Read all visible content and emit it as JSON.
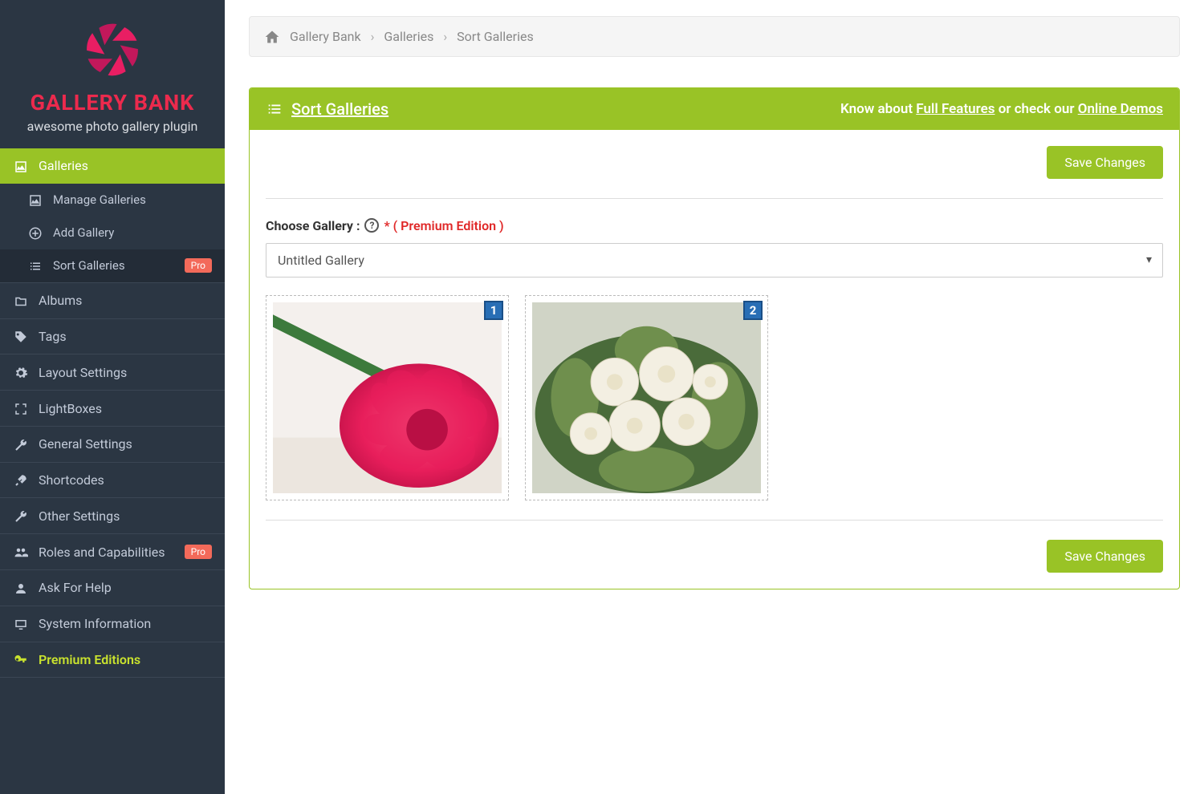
{
  "brand": {
    "name": "GALLERY BANK",
    "tagline": "awesome photo gallery plugin"
  },
  "sidebar": {
    "galleries_label": "Galleries",
    "sub": {
      "manage": "Manage Galleries",
      "add": "Add Gallery",
      "sort": "Sort Galleries"
    },
    "albums": "Albums",
    "tags": "Tags",
    "layout": "Layout Settings",
    "lightboxes": "LightBoxes",
    "general": "General Settings",
    "shortcodes": "Shortcodes",
    "other": "Other Settings",
    "roles": "Roles and Capabilities",
    "help": "Ask For Help",
    "system": "System Information",
    "premium": "Premium Editions",
    "pro_badge": "Pro"
  },
  "breadcrumb": {
    "root": "Gallery Bank",
    "l1": "Galleries",
    "l2": "Sort Galleries"
  },
  "panel": {
    "title": "Sort Galleries",
    "cta_pre": "Know about ",
    "cta_link1": "Full Features",
    "cta_mid": " or check our ",
    "cta_link2": "Online Demos",
    "save": "Save Changes",
    "choose_label": "Choose Gallery :",
    "premium_note": "* ( Premium Edition )",
    "select_value": "Untitled Gallery",
    "tiles": [
      "1",
      "2"
    ]
  }
}
